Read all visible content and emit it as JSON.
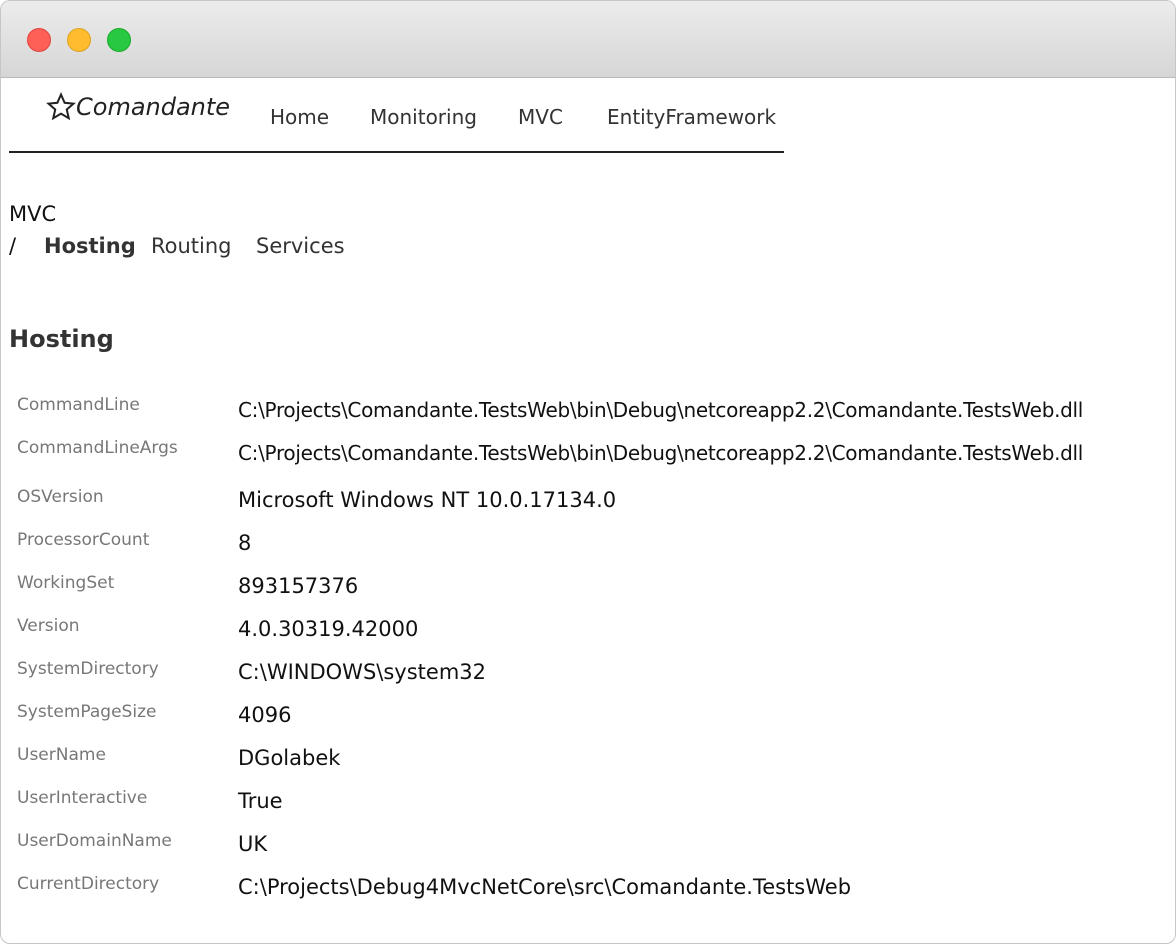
{
  "window": {
    "controls": [
      "close",
      "minimize",
      "maximize"
    ]
  },
  "navbar": {
    "brand": "Comandante",
    "brand_icon": "star-outline-icon",
    "links": [
      "Home",
      "Monitoring",
      "MVC",
      "EntityFramework"
    ]
  },
  "section": {
    "title": "MVC",
    "separator": "/",
    "tabs": [
      "Hosting",
      "Routing",
      "Services"
    ],
    "active_tab": "Hosting"
  },
  "page": {
    "heading": "Hosting"
  },
  "properties": [
    {
      "key": "CommandLine",
      "value": "C:\\Projects\\Comandante.TestsWeb\\bin\\Debug\\netcoreapp2.2\\Comandante.TestsWeb.dll"
    },
    {
      "key": "CommandLineArgs",
      "value": "C:\\Projects\\Comandante.TestsWeb\\bin\\Debug\\netcoreapp2.2\\Comandante.TestsWeb.dll"
    },
    {
      "key": "OSVersion",
      "value": "Microsoft Windows NT 10.0.17134.0"
    },
    {
      "key": "ProcessorCount",
      "value": "8"
    },
    {
      "key": "WorkingSet",
      "value": "893157376"
    },
    {
      "key": "Version",
      "value": "4.0.30319.42000"
    },
    {
      "key": "SystemDirectory",
      "value": "C:\\WINDOWS\\system32"
    },
    {
      "key": "SystemPageSize",
      "value": "4096"
    },
    {
      "key": "UserName",
      "value": "DGolabek"
    },
    {
      "key": "UserInteractive",
      "value": "True"
    },
    {
      "key": "UserDomainName",
      "value": "UK"
    },
    {
      "key": "CurrentDirectory",
      "value": "C:\\Projects\\Debug4MvcNetCore\\src\\Comandante.TestsWeb"
    }
  ]
}
